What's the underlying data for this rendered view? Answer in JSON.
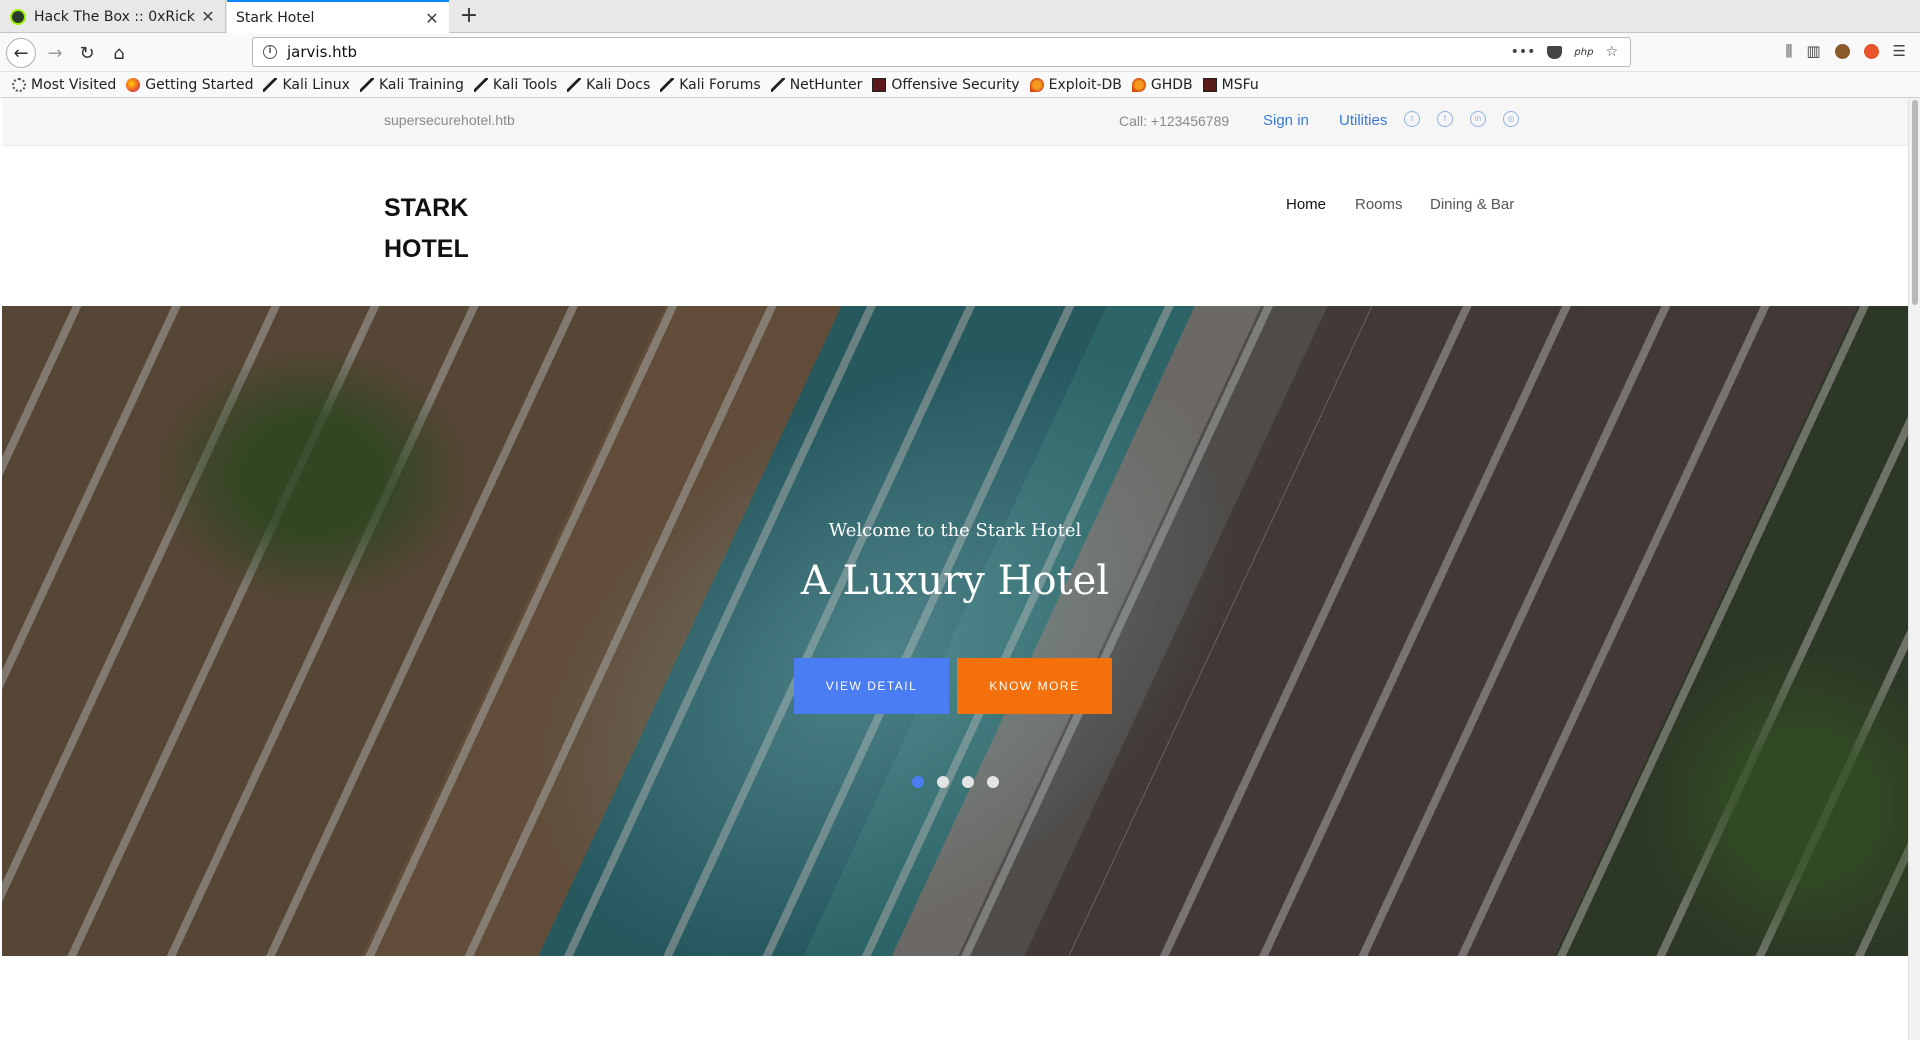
{
  "browser": {
    "tabs": [
      {
        "title": "Hack The Box :: 0xRick"
      },
      {
        "title": "Stark Hotel"
      }
    ],
    "url": "jarvis.htb",
    "bookmarks": [
      {
        "label": "Most Visited",
        "icon": "gear-icon"
      },
      {
        "label": "Getting Started",
        "icon": "firefox-icon"
      },
      {
        "label": "Kali Linux",
        "icon": "kali-icon"
      },
      {
        "label": "Kali Training",
        "icon": "kali-icon"
      },
      {
        "label": "Kali Tools",
        "icon": "kali-icon"
      },
      {
        "label": "Kali Docs",
        "icon": "kali-icon"
      },
      {
        "label": "Kali Forums",
        "icon": "kali-icon"
      },
      {
        "label": "NetHunter",
        "icon": "kali-icon"
      },
      {
        "label": "Offensive Security",
        "icon": "offsec-icon"
      },
      {
        "label": "Exploit-DB",
        "icon": "exploitdb-icon"
      },
      {
        "label": "GHDB",
        "icon": "exploitdb-icon"
      },
      {
        "label": "MSFu",
        "icon": "offsec-icon"
      }
    ]
  },
  "site": {
    "topbar": {
      "domain": "supersecurehotel.htb",
      "call": "Call: +123456789",
      "signin": "Sign in",
      "utilities": "Utilities",
      "social": [
        "twitter-icon",
        "facebook-icon",
        "linkedin-icon",
        "instagram-icon"
      ]
    },
    "brand": {
      "line1": "STARK",
      "line2": "HOTEL"
    },
    "menu": [
      {
        "label": "Home",
        "active": true
      },
      {
        "label": "Rooms",
        "active": false
      },
      {
        "label": "Dining & Bar",
        "active": false
      }
    ],
    "hero": {
      "subtitle": "Welcome to the Stark Hotel",
      "title": "A Luxury Hotel",
      "primary_button": "VIEW DETAIL",
      "secondary_button": "KNOW MORE",
      "slides_total": 4,
      "active_slide": 1
    }
  },
  "colors": {
    "accent_blue": "#4a7cf4",
    "accent_orange": "#f4700c",
    "link_blue": "#3a7bd5"
  }
}
